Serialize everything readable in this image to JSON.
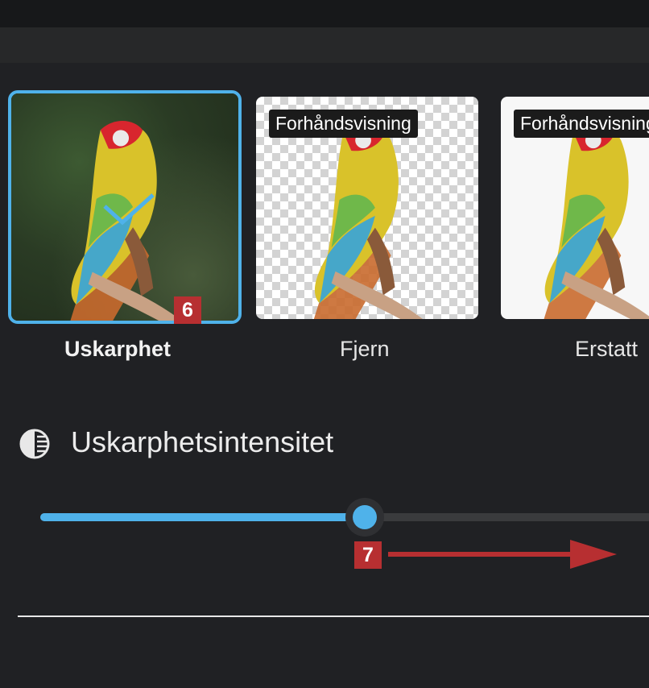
{
  "cards": [
    {
      "label": "Uskarphet",
      "selected": true,
      "badge": "6"
    },
    {
      "label": "Fjern",
      "tag": "Forhåndsvisning"
    },
    {
      "label": "Erstatt",
      "tag": "Forhåndsvisning"
    }
  ],
  "section": {
    "title": "Uskarphetsintensitet",
    "icon": "contrast-icon"
  },
  "slider": {
    "value_fraction": 0.53
  },
  "callout": {
    "badge": "7"
  },
  "colors": {
    "accent": "#4fb2ea",
    "badge": "#b72f31",
    "background": "#202124"
  }
}
